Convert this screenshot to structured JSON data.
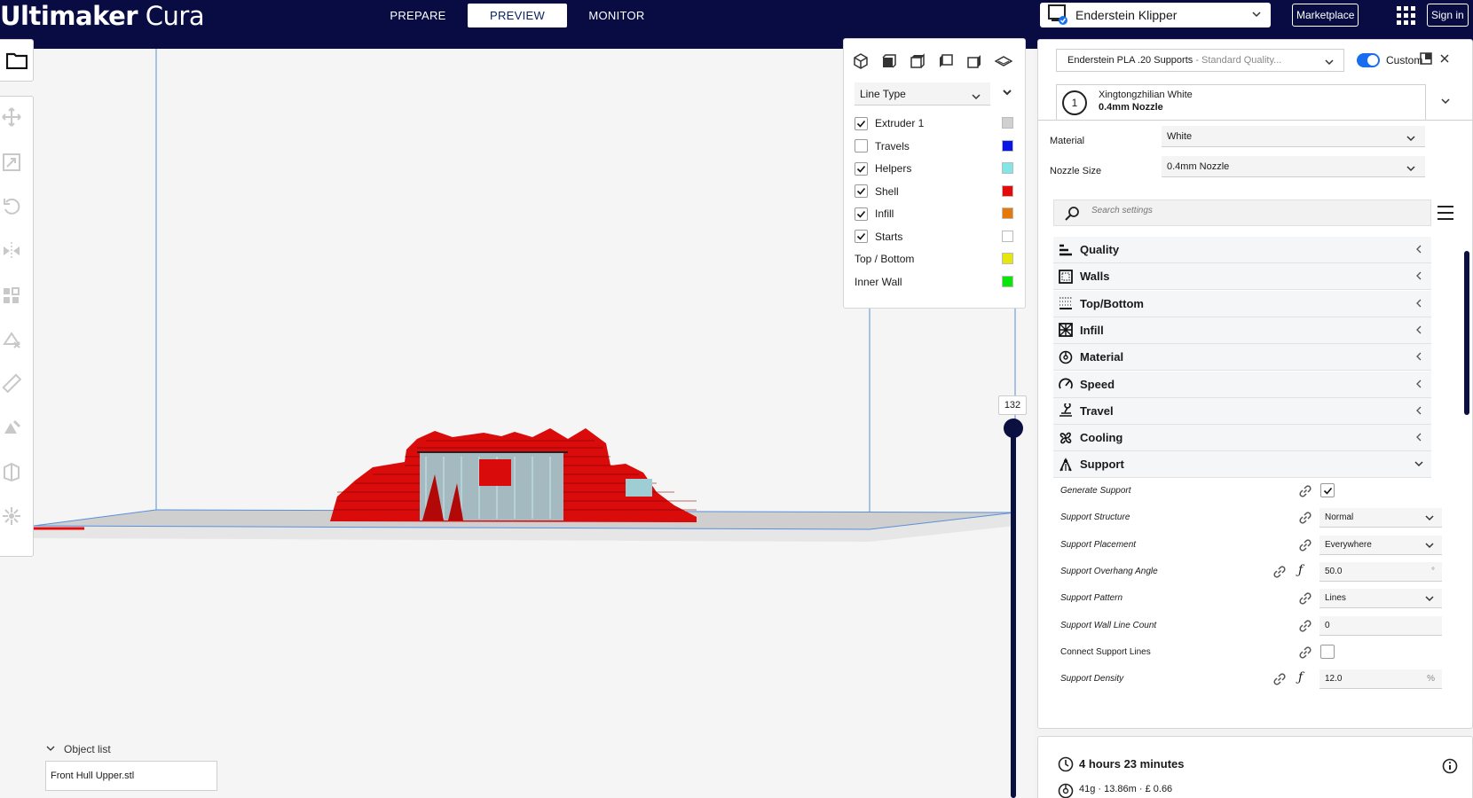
{
  "app": {
    "title_bold": "Ultimaker",
    "title_light": "Cura"
  },
  "stages": [
    {
      "label": "PREPARE",
      "active": false
    },
    {
      "label": "PREVIEW",
      "active": true
    },
    {
      "label": "MONITOR",
      "active": false
    }
  ],
  "header": {
    "printer": "Enderstein Klipper",
    "marketplace": "Marketplace",
    "signin": "Sign in"
  },
  "view_panel": {
    "color_scheme": "Line Type",
    "legend": [
      {
        "label": "Extruder 1",
        "checkbox": true,
        "checked": true,
        "color": "#d0d0d0"
      },
      {
        "label": "Travels",
        "checkbox": true,
        "checked": false,
        "color": "#0a14e6"
      },
      {
        "label": "Helpers",
        "checkbox": true,
        "checked": true,
        "color": "#82e6e6"
      },
      {
        "label": "Shell",
        "checkbox": true,
        "checked": true,
        "color": "#e60a0a"
      },
      {
        "label": "Infill",
        "checkbox": true,
        "checked": true,
        "color": "#e6780a"
      },
      {
        "label": "Starts",
        "checkbox": true,
        "checked": true,
        "color": "#ffffff"
      },
      {
        "label": "Top / Bottom",
        "checkbox": false,
        "checked": false,
        "color": "#e6e60a"
      },
      {
        "label": "Inner Wall",
        "checkbox": false,
        "checked": false,
        "color": "#0ae60a"
      }
    ]
  },
  "layer_slider": {
    "value": "132"
  },
  "object_list": {
    "label": "Object list",
    "item": "Front Hull Upper.stl"
  },
  "settings": {
    "profile_name": "Enderstein PLA .20 Supports",
    "profile_quality": " - Standard Quality...",
    "custom_label": "Custom",
    "extruder": {
      "number": "1",
      "material": "Xingtongzhilian White",
      "nozzle": "0.4mm Nozzle"
    },
    "material_label": "Material",
    "material_value": "White",
    "nozzle_label": "Nozzle Size",
    "nozzle_value": "0.4mm Nozzle",
    "search_placeholder": "Search settings",
    "categories": [
      {
        "label": "Quality",
        "icon": "quality-icon"
      },
      {
        "label": "Walls",
        "icon": "walls-icon"
      },
      {
        "label": "Top/Bottom",
        "icon": "top-bottom-icon"
      },
      {
        "label": "Infill",
        "icon": "infill-icon"
      },
      {
        "label": "Material",
        "icon": "material-icon"
      },
      {
        "label": "Speed",
        "icon": "speed-icon"
      },
      {
        "label": "Travel",
        "icon": "travel-icon"
      },
      {
        "label": "Cooling",
        "icon": "cooling-icon"
      },
      {
        "label": "Support",
        "icon": "support-icon"
      }
    ],
    "support_settings": [
      {
        "label": "Generate Support",
        "type": "checkbox",
        "checked": true
      },
      {
        "label": "Support Structure",
        "type": "select",
        "value": "Normal"
      },
      {
        "label": "Support Placement",
        "type": "select",
        "value": "Everywhere"
      },
      {
        "label": "Support Overhang Angle",
        "type": "input",
        "value": "50.0",
        "unit": "°",
        "fx": true
      },
      {
        "label": "Support Pattern",
        "type": "select",
        "value": "Lines"
      },
      {
        "label": "Support Wall Line Count",
        "type": "input",
        "value": "0",
        "unit": ""
      },
      {
        "label": "Connect Support Lines",
        "type": "checkbox",
        "checked": false,
        "plain": true
      },
      {
        "label": "Support Density",
        "type": "input",
        "value": "12.0",
        "unit": "%",
        "fx": true
      }
    ]
  },
  "summary": {
    "time": "4 hours 23 minutes",
    "material": "41g · 13.86m · £ 0.66"
  },
  "colors": {
    "header_bg": "#080c42",
    "accent": "#196ef0",
    "shell_red": "#e60a0a"
  }
}
